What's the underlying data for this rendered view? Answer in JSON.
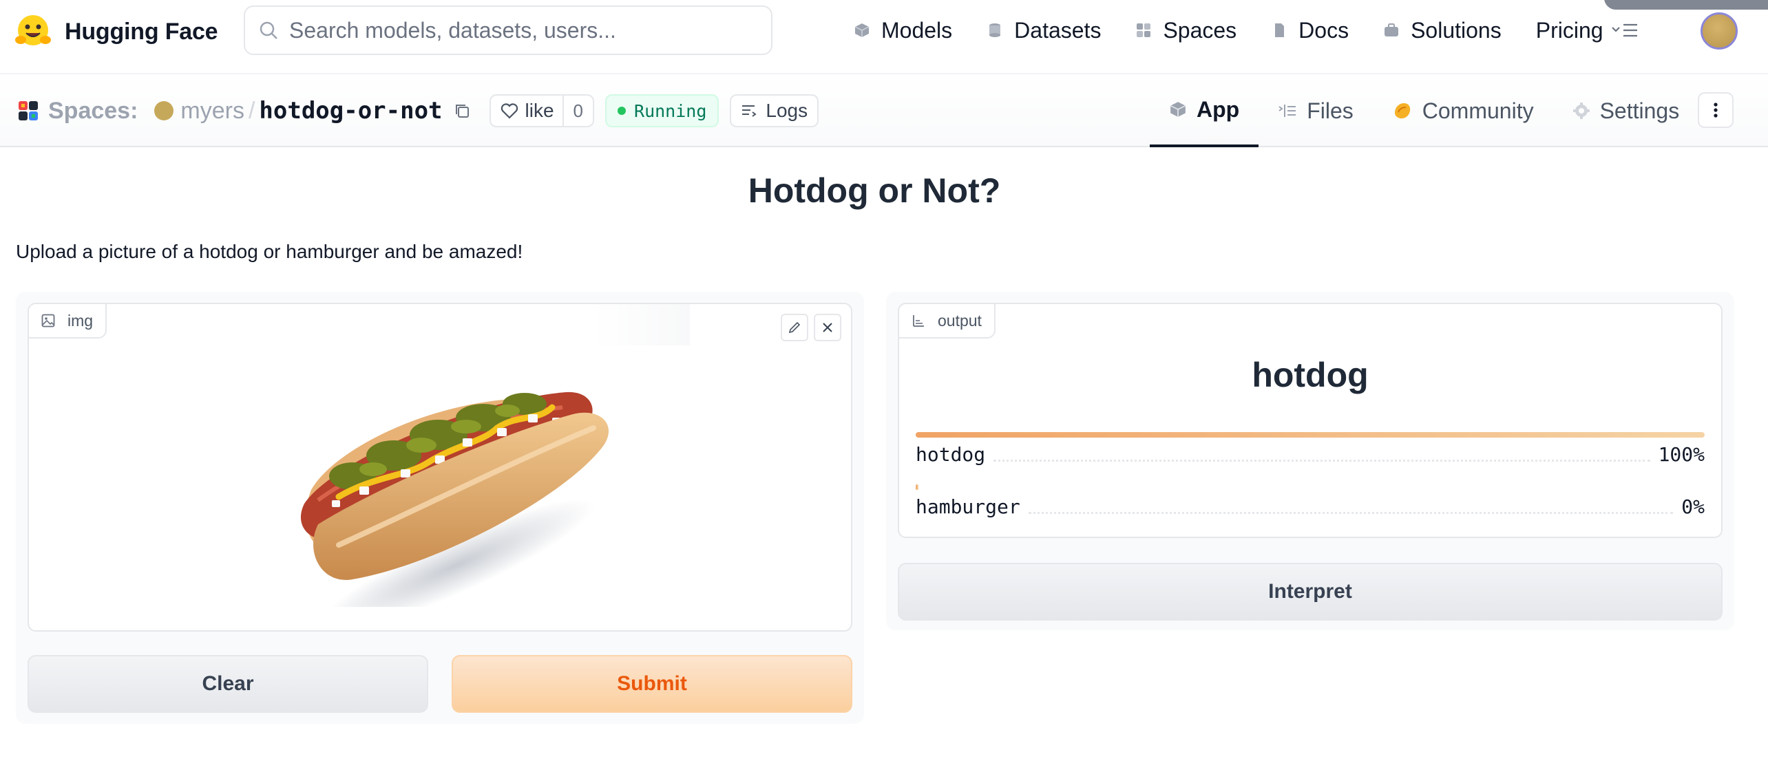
{
  "brand": {
    "name": "Hugging Face"
  },
  "search": {
    "placeholder": "Search models, datasets, users..."
  },
  "nav": {
    "links": [
      {
        "label": "Models",
        "icon": "cube-icon"
      },
      {
        "label": "Datasets",
        "icon": "database-icon"
      },
      {
        "label": "Spaces",
        "icon": "grid-icon"
      },
      {
        "label": "Docs",
        "icon": "document-icon"
      },
      {
        "label": "Solutions",
        "icon": "briefcase-icon"
      },
      {
        "label": "Pricing",
        "icon": ""
      }
    ]
  },
  "space": {
    "spaces_label": "Spaces:",
    "owner": "myers",
    "separator": "/",
    "repo": "hotdog-or-not",
    "like_label": "like",
    "like_count": "0",
    "status": "Running",
    "logs_label": "Logs",
    "tabs": [
      {
        "label": "App",
        "active": true
      },
      {
        "label": "Files",
        "active": false
      },
      {
        "label": "Community",
        "active": false
      },
      {
        "label": "Settings",
        "active": false
      }
    ]
  },
  "app": {
    "title": "Hotdog or Not?",
    "description": "Upload a picture of a hotdog or hamburger and be amazed!",
    "input": {
      "label": "img"
    },
    "buttons": {
      "clear": "Clear",
      "submit": "Submit",
      "interpret": "Interpret"
    },
    "output": {
      "label": "output",
      "top_label": "hotdog",
      "confidences": [
        {
          "label": "hotdog",
          "value_text": "100%",
          "fraction": 1.0
        },
        {
          "label": "hamburger",
          "value_text": "0%",
          "fraction": 0.0
        }
      ]
    }
  },
  "colors": {
    "accent_orange": "#ea580c",
    "submit_bg": "#fbcf9e",
    "running_green": "#047857",
    "bar_gradient_start": "#f0a365",
    "bar_gradient_end": "#f5d3a5"
  }
}
